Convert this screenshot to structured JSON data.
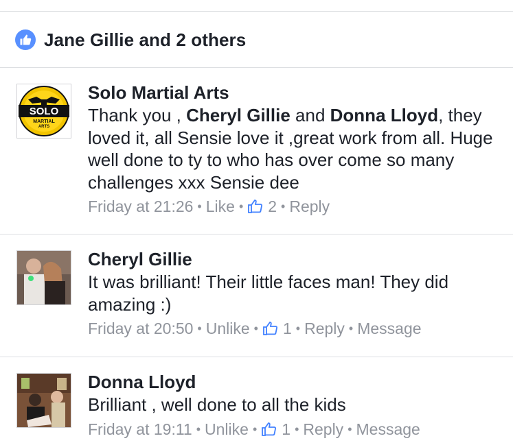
{
  "reactions": {
    "summary": "Jane Gillie and 2 others"
  },
  "comments": [
    {
      "author": "Solo Martial Arts",
      "text_parts": [
        "Thank you , ",
        "Cheryl Gillie",
        " and ",
        "Donna Lloyd",
        ", they loved it, all Sensie love it ,great work from all. Huge well done to ty to who has over come so many challenges xxx Sensie dee"
      ],
      "time": "Friday at 21:26",
      "like_action": "Like",
      "like_count": "2",
      "reply": "Reply",
      "logo": {
        "top": "SOLO",
        "bottom1": "MARTIAL",
        "bottom2": "ARTS"
      }
    },
    {
      "author": "Cheryl Gillie",
      "text": "It was brilliant! Their little faces man!  They did amazing :)",
      "time": "Friday at 20:50",
      "like_action": "Unlike",
      "like_count": "1",
      "reply": "Reply",
      "message": "Message"
    },
    {
      "author": "Donna Lloyd",
      "text": "Brilliant , well done to all the kids",
      "time": "Friday at 19:11",
      "like_action": "Unlike",
      "like_count": "1",
      "reply": "Reply",
      "message": "Message"
    }
  ],
  "colors": {
    "like_blue": "#5890ff",
    "liked_blue": "#4080ff",
    "meta_gray": "#90949c",
    "divider": "#dddfe2"
  }
}
